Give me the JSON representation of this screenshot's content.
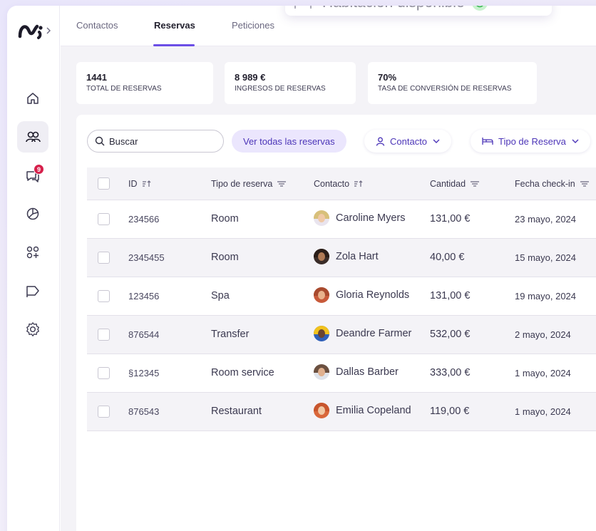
{
  "toast": {
    "text": "Habitación disponible"
  },
  "tabs": [
    {
      "label": "Contactos"
    },
    {
      "label": "Reservas"
    },
    {
      "label": "Peticiones"
    }
  ],
  "sidebar": {
    "items": [
      {
        "icon": "home-icon"
      },
      {
        "icon": "users-icon"
      },
      {
        "icon": "chat-icon",
        "badge": "9"
      },
      {
        "icon": "pie-chart-icon"
      },
      {
        "icon": "apps-icon"
      },
      {
        "icon": "megaphone-icon"
      },
      {
        "icon": "settings-icon"
      }
    ]
  },
  "stats": [
    {
      "value": "1441",
      "label": "TOTAL DE RESERVAS"
    },
    {
      "value": "8 989 €",
      "label": "INGRESOS DE RESERVAS"
    },
    {
      "value": "70%",
      "label": "TASA DE CONVERSIÓN DE RESERVAS"
    }
  ],
  "toolbar": {
    "search_placeholder": "Buscar",
    "view_all": "Ver todas las reservas",
    "filter_contact": "Contacto",
    "filter_type": "Tipo de Reserva"
  },
  "table": {
    "headers": [
      "ID",
      "Tipo de reserva",
      "Contacto",
      "Cantidad",
      "Fecha check-in"
    ],
    "rows": [
      {
        "id": "234566",
        "tipo": "Room",
        "contacto": "Caroline Myers",
        "cantidad": "131,00 €",
        "fecha": "23 mayo, 2024"
      },
      {
        "id": "2345455",
        "tipo": "Room",
        "contacto": "Zola Hart",
        "cantidad": "40,00 €",
        "fecha": "15 mayo, 2024"
      },
      {
        "id": "123456",
        "tipo": "Spa",
        "contacto": "Gloria Reynolds",
        "cantidad": "131,00 €",
        "fecha": "19 mayo, 2024"
      },
      {
        "id": "876544",
        "tipo": "Transfer",
        "contacto": "Deandre Farmer",
        "cantidad": "532,00 €",
        "fecha": "2 mayo, 2024"
      },
      {
        "id": "§12345",
        "tipo": "Room service",
        "contacto": "Dallas Barber",
        "cantidad": "333,00 €",
        "fecha": "1 mayo, 2024"
      },
      {
        "id": "876543",
        "tipo": "Restaurant",
        "contacto": "Emilia Copeland",
        "cantidad": "119,00 €",
        "fecha": "1 mayo, 2024"
      }
    ]
  },
  "colors": {
    "accent": "#6b4ee6",
    "badge": "#d6204b",
    "primary_text": "#4c35b8"
  }
}
